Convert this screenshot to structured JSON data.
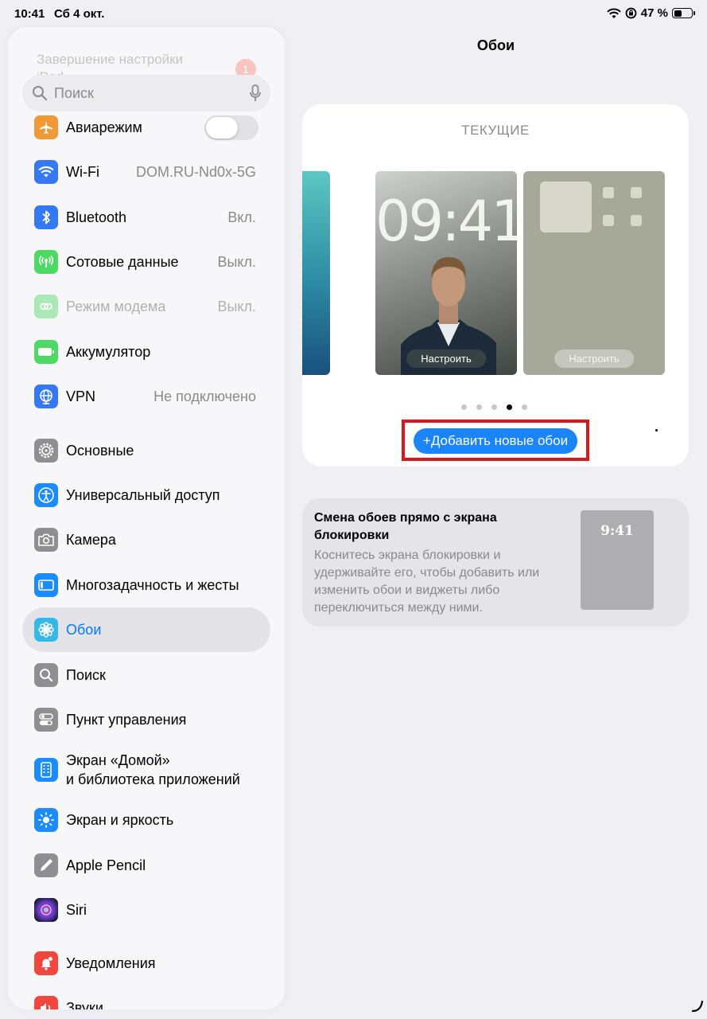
{
  "status_bar": {
    "time": "10:41",
    "date": "Сб 4 окт.",
    "battery_text": "47 %",
    "battery_level": 0.47
  },
  "sidebar": {
    "banner_text": "Завершение настройки iPad",
    "banner_badge": "1",
    "search_placeholder": "Поиск",
    "items": [
      {
        "label": "Авиарежим",
        "value": "",
        "icon": "airplane-icon",
        "color": "#f09a37"
      },
      {
        "label": "Wi-Fi",
        "value": "DOM.RU-Nd0x-5G",
        "icon": "wifi-icon",
        "color": "#3478f6"
      },
      {
        "label": "Bluetooth",
        "value": "Вкл.",
        "icon": "bluetooth-icon",
        "color": "#3478f6"
      },
      {
        "label": "Сотовые данные",
        "value": "Выкл.",
        "icon": "antenna-icon",
        "color": "#4cd964"
      },
      {
        "label": "Режим модема",
        "value": "Выкл.",
        "icon": "hotspot-icon",
        "color": "#4cd964"
      },
      {
        "label": "Аккумулятор",
        "value": "",
        "icon": "battery-icon",
        "color": "#4cd964"
      },
      {
        "label": "VPN",
        "value": "Не подключено",
        "icon": "globe-icon",
        "color": "#3478f6"
      },
      {
        "label": "Основные",
        "value": "",
        "icon": "gear-icon",
        "color": "#8e8e93"
      },
      {
        "label": "Универсальный доступ",
        "value": "",
        "icon": "accessibility-icon",
        "color": "#1a8cff"
      },
      {
        "label": "Камера",
        "value": "",
        "icon": "camera-icon",
        "color": "#8e8e93"
      },
      {
        "label": "Многозадачность и жесты",
        "value": "",
        "icon": "multitasking-icon",
        "color": "#1a8cff"
      },
      {
        "label": "Обои",
        "value": "",
        "icon": "flower-icon",
        "color": "#33b8e8"
      },
      {
        "label": "Поиск",
        "value": "",
        "icon": "search-icon",
        "color": "#8e8e93"
      },
      {
        "label": "Пункт управления",
        "value": "",
        "icon": "switches-icon",
        "color": "#8e8e93"
      },
      {
        "label": "Экран «Домой»",
        "label2": "и библиотека приложений",
        "value": "",
        "icon": "home-screen-icon",
        "color": "#1a8cff"
      },
      {
        "label": "Экран и яркость",
        "value": "",
        "icon": "sun-icon",
        "color": "#1a8cff"
      },
      {
        "label": "Apple Pencil",
        "value": "",
        "icon": "pencil-icon",
        "color": "#8e8e93"
      },
      {
        "label": "Siri",
        "value": "",
        "icon": "siri-icon",
        "color": "#222222"
      },
      {
        "label": "Уведомления",
        "value": "",
        "icon": "bell-icon",
        "color": "#f2453d"
      },
      {
        "label": "Звуки",
        "value": "",
        "icon": "speaker-icon",
        "color": "#f2453d"
      }
    ]
  },
  "main": {
    "title": "Обои",
    "current_label": "ТЕКУЩИЕ",
    "lock_clock": "09:41",
    "customize_label": "Настроить",
    "add_button": "+Добавить новые обои",
    "page_count": 5,
    "active_page": 4,
    "tip": {
      "title": "Смена обоев прямо с экрана блокировки",
      "body": "Коснитесь экрана блокировки и удерживайте его, чтобы добавить или изменить обои и виджеты либо переключиться между ними.",
      "preview_time": "9:41"
    }
  }
}
